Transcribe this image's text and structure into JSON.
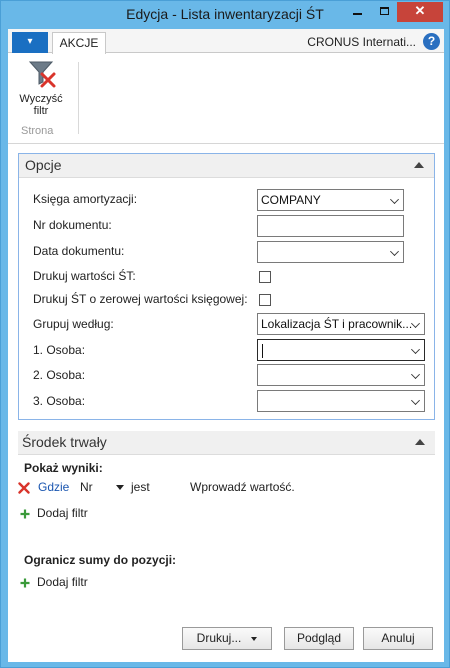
{
  "window": {
    "title": "Edycja - Lista inwentaryzacji ŚT",
    "minimize_label": "",
    "close_label": "✕"
  },
  "ribbon": {
    "menu_arrow": "▾",
    "tab_label": "AKCJE",
    "company": "CRONUS Internati...",
    "help_label": "?",
    "clear_filter_line1": "Wyczyść",
    "clear_filter_line2": "filtr",
    "group_label": "Strona"
  },
  "opcje": {
    "header": "Opcje",
    "fields": {
      "ksiega_label": "Księga amortyzacji:",
      "ksiega_value": "COMPANY",
      "nr_dok_label": "Nr dokumentu:",
      "nr_dok_value": "",
      "data_dok_label": "Data dokumentu:",
      "data_dok_value": "",
      "drukuj_wartosci_label": "Drukuj wartości ŚT:",
      "drukuj_zero_label": "Drukuj ŚT o zerowej wartości księgowej:",
      "grupuj_label": "Grupuj według:",
      "grupuj_value": "Lokalizacja ŚT i pracownik...",
      "osoba1_label": "1. Osoba:",
      "osoba1_value": "",
      "osoba2_label": "2. Osoba:",
      "osoba2_value": "",
      "osoba3_label": "3. Osoba:",
      "osoba3_value": ""
    }
  },
  "srodek": {
    "header": "Środek trwały",
    "pokaz_wyniki": "Pokaż wyniki:",
    "filter_where": "Gdzie",
    "filter_field": "Nr",
    "filter_op": "jest",
    "filter_value": "Wprowadź wartość.",
    "add_filter": "Dodaj filtr",
    "ogranicz": "Ogranicz sumy do pozycji:",
    "add_filter2": "Dodaj filtr"
  },
  "buttons": {
    "drukuj": "Drukuj...",
    "podglad": "Podgląd",
    "anuluj": "Anuluj"
  },
  "colors": {
    "titlebar": "#69b8e8",
    "close": "#c7443a",
    "menu": "#1a6fc2",
    "link": "#1a56b0",
    "panel_border": "#8ab4e8"
  }
}
